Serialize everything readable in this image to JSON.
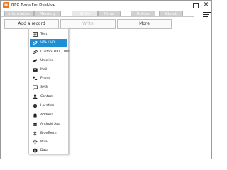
{
  "window": {
    "title": "NFC Tools For Desktop",
    "app_icon": "nfc-logo-icon",
    "brand_color": "#e87722",
    "close_glyph": "✕"
  },
  "tabs": [
    {
      "label": "Information",
      "active": false
    },
    {
      "label": "Memory",
      "active": false
    },
    {
      "label": "Write",
      "active": true
    },
    {
      "label": "Other",
      "active": false
    },
    {
      "label": "Option",
      "active": false
    },
    {
      "label": "About",
      "active": false
    }
  ],
  "toolbar": {
    "add_record_label": "Add a record",
    "write_label": "Write",
    "more_label": "More"
  },
  "dropdown": {
    "selected_color": "#1e8fd5",
    "items": [
      {
        "label": "Text",
        "icon": "text-icon",
        "selected": false
      },
      {
        "label": "URL / URI",
        "icon": "link-icon",
        "selected": true
      },
      {
        "label": "Custom URL / URI",
        "icon": "custom-link-icon",
        "selected": false
      },
      {
        "label": "Uniclink",
        "icon": "uniclink-icon",
        "selected": false
      },
      {
        "label": "Mail",
        "icon": "mail-icon",
        "selected": false
      },
      {
        "label": "Phone",
        "icon": "phone-icon",
        "selected": false
      },
      {
        "label": "SMS",
        "icon": "sms-icon",
        "selected": false
      },
      {
        "label": "Contact",
        "icon": "contact-icon",
        "selected": false
      },
      {
        "label": "Location",
        "icon": "location-icon",
        "selected": false
      },
      {
        "label": "Address",
        "icon": "address-icon",
        "selected": false
      },
      {
        "label": "Android App",
        "icon": "android-icon",
        "selected": false
      },
      {
        "label": "BlueTooth",
        "icon": "bluetooth-icon",
        "selected": false
      },
      {
        "label": "Wi-Fi",
        "icon": "wifi-icon",
        "selected": false
      },
      {
        "label": "Data",
        "icon": "data-icon",
        "selected": false
      }
    ]
  }
}
